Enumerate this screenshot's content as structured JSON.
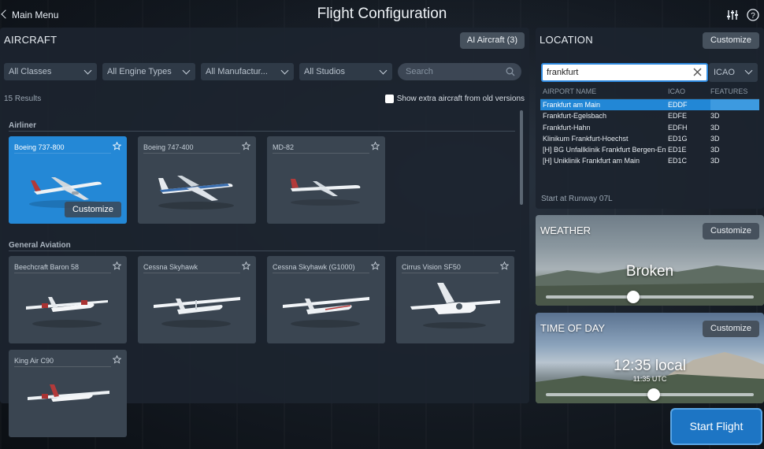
{
  "header": {
    "back_label": "Main Menu",
    "title": "Flight Configuration",
    "icons": [
      "sliders-icon",
      "help-icon"
    ]
  },
  "aircraft": {
    "heading": "AIRCRAFT",
    "ai_button": "AI Aircraft (3)",
    "filters": [
      "All Classes",
      "All Engine Types",
      "All Manufactur...",
      "All Studios"
    ],
    "search_placeholder": "Search",
    "results": "15 Results",
    "show_old": "Show extra aircraft from old versions",
    "categories": [
      {
        "label": "Airliner",
        "items": [
          {
            "name": "Boeing 737-800",
            "selected": true
          },
          {
            "name": "Boeing 747-400",
            "selected": false
          },
          {
            "name": "MD-82",
            "selected": false
          }
        ]
      },
      {
        "label": "General Aviation",
        "items": [
          {
            "name": "Beechcraft Baron 58",
            "selected": false
          },
          {
            "name": "Cessna Skyhawk",
            "selected": false
          },
          {
            "name": "Cessna Skyhawk (G1000)",
            "selected": false
          },
          {
            "name": "Cirrus Vision SF50",
            "selected": false
          },
          {
            "name": "King Air C90",
            "selected": false
          }
        ]
      }
    ],
    "customize_label": "Customize"
  },
  "location": {
    "heading": "LOCATION",
    "customize": "Customize",
    "search_value": "frankfurt",
    "code_filter": "ICAO",
    "columns": [
      "AIRPORT NAME",
      "ICAO",
      "FEATURES"
    ],
    "rows": [
      {
        "name": "Frankfurt am Main",
        "icao": "EDDF",
        "features": "",
        "selected": true
      },
      {
        "name": "Frankfurt-Egelsbach",
        "icao": "EDFE",
        "features": "3D",
        "selected": false
      },
      {
        "name": "Frankfurt-Hahn",
        "icao": "EDFH",
        "features": "3D",
        "selected": false
      },
      {
        "name": "Klinikum Frankfurt-Hoechst",
        "icao": "ED1G",
        "features": "3D",
        "selected": false
      },
      {
        "name": "[H] BG Unfallklinik Frankfurt Bergen-En",
        "icao": "ED1E",
        "features": "3D",
        "selected": false
      },
      {
        "name": "[H] Uniklinik Frankfurt am Main",
        "icao": "ED1C",
        "features": "3D",
        "selected": false
      }
    ],
    "start_runway": "Start at Runway 07L"
  },
  "weather": {
    "heading": "WEATHER",
    "customize": "Customize",
    "value": "Broken",
    "slider_fraction": 0.42
  },
  "time_of_day": {
    "heading": "TIME OF DAY",
    "customize": "Customize",
    "local": "12:35 local",
    "utc": "11:35 UTC",
    "slider_fraction": 0.52
  },
  "start_button": "Start Flight",
  "colors": {
    "accent": "#2488d6",
    "panel": "#1c242f",
    "button": "#46515d"
  }
}
